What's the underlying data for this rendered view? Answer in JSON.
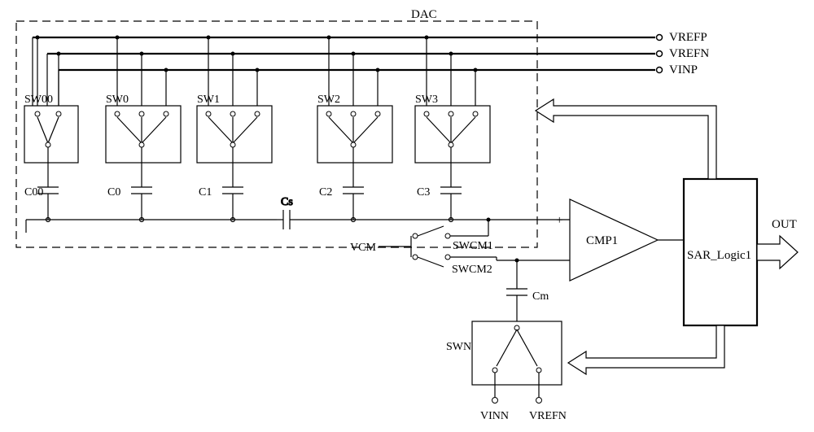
{
  "labels": {
    "dac_box": "DAC",
    "vrefp": "VREFP",
    "vrefn": "VREFN",
    "vinp": "VINP",
    "sw00": "SW00",
    "sw0": "SW0",
    "sw1": "SW1",
    "sw2": "SW2",
    "sw3": "SW3",
    "c00": "C00",
    "c0": "C0",
    "c1": "C1",
    "c2": "C2",
    "c3": "C3",
    "cs": "Cs",
    "vcm": "VCM",
    "swcm1": "SWCM1",
    "swcm2": "SWCM2",
    "cmp1": "CMP1",
    "sar": "SAR_Logic1",
    "out": "OUT",
    "cm": "Cm",
    "swn": "SWN",
    "vinn": "VINN",
    "vrefn_bot": "VREFN",
    "plus": "+",
    "minus": "−"
  },
  "chart_data": {
    "type": "circuit-diagram",
    "description": "SAR ADC block diagram with split-capacitor DAC",
    "dac": {
      "switch_groups": [
        {
          "name": "SW00",
          "throws": 2,
          "cap": "C00"
        },
        {
          "name": "SW0",
          "throws": 3,
          "cap": "C0"
        },
        {
          "name": "SW1",
          "throws": 3,
          "cap": "C1"
        },
        {
          "name": "SW2",
          "throws": 3,
          "cap": "C2"
        },
        {
          "name": "SW3",
          "throws": 3,
          "cap": "C3"
        }
      ],
      "series_cap_between_groups": {
        "name": "Cs",
        "between": [
          "C1",
          "C2"
        ]
      },
      "rails": [
        "VREFP",
        "VREFN",
        "VINP"
      ]
    },
    "comparator": {
      "name": "CMP1",
      "in_pos_from": "DAC top plate (right segment)",
      "in_neg_from": "SWCM2 / Cm",
      "common_mode": {
        "signal": "VCM",
        "switches": [
          "SWCM1",
          "SWCM2"
        ]
      }
    },
    "minus_path": {
      "cap": "Cm",
      "switch_group": {
        "name": "SWN",
        "throws": 2,
        "inputs": [
          "VINN",
          "VREFN"
        ]
      }
    },
    "logic": {
      "name": "SAR_Logic1",
      "controls": [
        "DAC switches",
        "SWN"
      ],
      "output": "OUT"
    }
  }
}
